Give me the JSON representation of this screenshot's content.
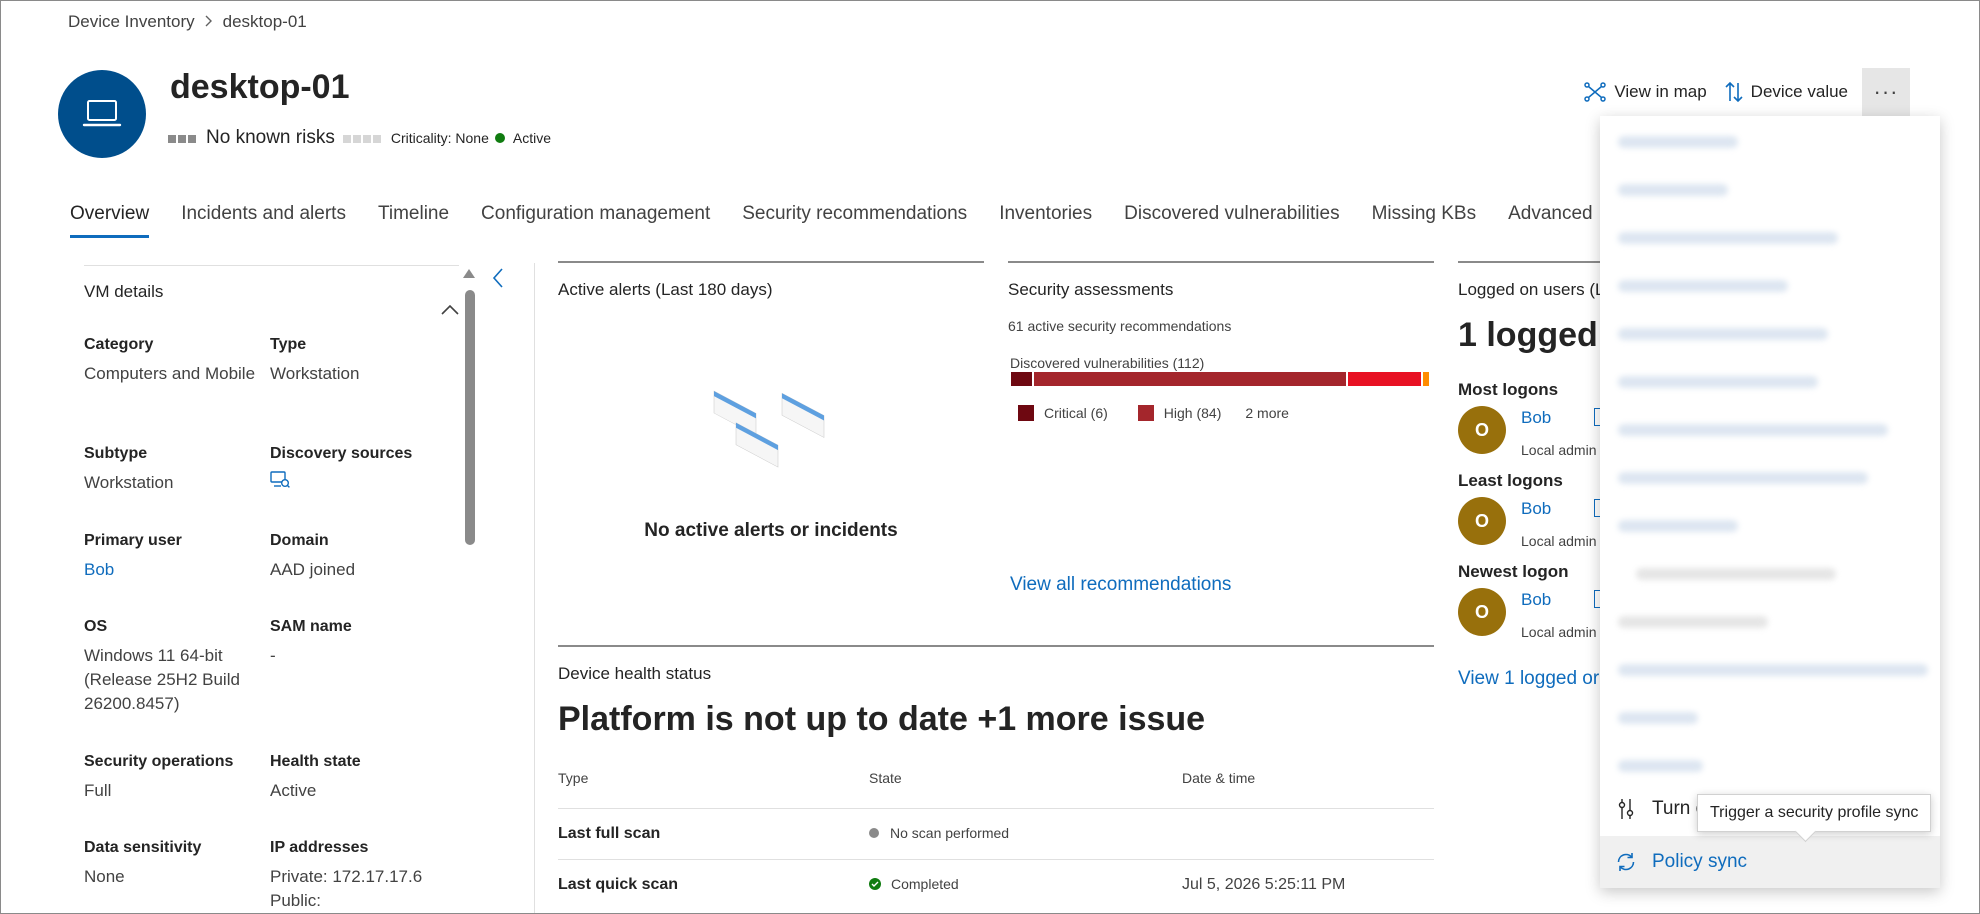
{
  "breadcrumb": {
    "root": "Device Inventory",
    "current": "desktop-01"
  },
  "device": {
    "name": "desktop-01",
    "risk": "No known risks",
    "criticality": "Criticality: None",
    "status": "Active"
  },
  "actions": {
    "view_in_map": "View in map",
    "device_value": "Device value",
    "more": "···"
  },
  "tabs": [
    {
      "label": "Overview"
    },
    {
      "label": "Incidents and alerts"
    },
    {
      "label": "Timeline"
    },
    {
      "label": "Configuration management"
    },
    {
      "label": "Security recommendations"
    },
    {
      "label": "Inventories"
    },
    {
      "label": "Discovered vulnerabilities"
    },
    {
      "label": "Missing KBs"
    },
    {
      "label": "Advanced"
    }
  ],
  "vm_details": {
    "title": "VM details",
    "category": {
      "label": "Category",
      "value": "Computers and Mobile"
    },
    "type": {
      "label": "Type",
      "value": "Workstation"
    },
    "subtype": {
      "label": "Subtype",
      "value": "Workstation"
    },
    "discovery": {
      "label": "Discovery sources"
    },
    "primary_user": {
      "label": "Primary user",
      "value": "Bob"
    },
    "domain": {
      "label": "Domain",
      "value": "AAD joined"
    },
    "os": {
      "label": "OS",
      "value": "Windows 11 64-bit (Release 25H2 Build 26200.8457)"
    },
    "sam": {
      "label": "SAM name",
      "value": "-"
    },
    "secops": {
      "label": "Security operations",
      "value": "Full"
    },
    "health": {
      "label": "Health state",
      "value": "Active"
    },
    "sensitivity": {
      "label": "Data sensitivity",
      "value": "None"
    },
    "ip": {
      "label": "IP addresses",
      "private": "Private: 172.17.17.6",
      "public": "Public:"
    }
  },
  "active_alerts": {
    "title": "Active alerts (Last 180 days)",
    "empty": "No active alerts or incidents"
  },
  "security": {
    "title": "Security assessments",
    "subtitle": "61 active security recommendations",
    "vuln_label": "Discovered vulnerabilities (112)",
    "critical": 6,
    "high": 84,
    "medium": 20,
    "low": 2,
    "legend_critical": "Critical (6)",
    "legend_high": "High (84)",
    "legend_more": "2 more",
    "view_all": "View all recommendations",
    "colors": {
      "critical": "#6e0811",
      "high": "#a4262c",
      "medium": "#e81123",
      "low": "#ff8c00"
    }
  },
  "health": {
    "title": "Device health status",
    "headline": "Platform is not up to date +1 more issue",
    "col_type": "Type",
    "col_state": "State",
    "col_date": "Date & time",
    "rows": [
      {
        "type": "Last full scan",
        "state": "No scan performed",
        "date": ""
      },
      {
        "type": "Last quick scan",
        "state": "Completed",
        "date": "Jul 5, 2026 5:25:11 PM"
      }
    ]
  },
  "logged_users": {
    "title": "Logged on users (L",
    "big": "1 logged",
    "most": "Most logons",
    "least": "Least logons",
    "newest": "Newest logon",
    "user_initial": "O",
    "user_name": "Bob",
    "user_role": "Local admin",
    "view_link": "View 1 logged or"
  },
  "menu": {
    "turn_on": "Turn o",
    "policy_sync": "Policy sync",
    "tooltip": "Trigger a security profile sync"
  }
}
